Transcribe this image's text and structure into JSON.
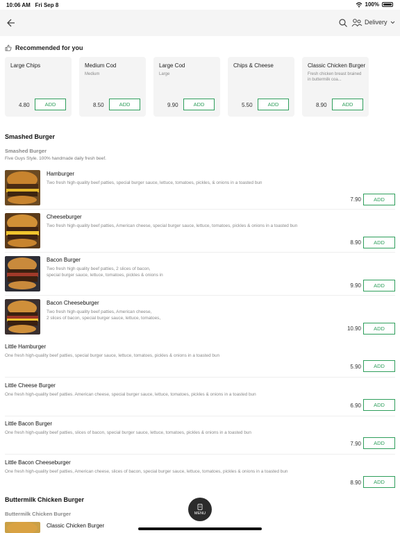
{
  "status": {
    "time": "10:06 AM",
    "date": "Fri Sep 8",
    "battery": "100%"
  },
  "header": {
    "delivery_label": "Delivery"
  },
  "recommended": {
    "title": "Recommended for you",
    "items": [
      {
        "name": "Large Chips",
        "desc": "",
        "price": "4.80",
        "button": "ADD"
      },
      {
        "name": "Medium Cod",
        "desc": "Medium",
        "price": "8.50",
        "button": "ADD"
      },
      {
        "name": "Large Cod",
        "desc": "Large",
        "price": "9.90",
        "button": "ADD"
      },
      {
        "name": "Chips & Cheese",
        "desc": "",
        "price": "5.50",
        "button": "ADD"
      },
      {
        "name": "Classic Chicken Burger",
        "desc": "Fresh chicken breast brained in buttermilk coa...",
        "price": "8.90",
        "button": "ADD"
      }
    ]
  },
  "section1": {
    "title": "Smashed Burger",
    "subtitle": "Smashed Burger",
    "subdesc": "Five Guys Style. 100% handmade daily fresh beef.",
    "items": [
      {
        "name": "Hamburger",
        "desc": "Two fresh high-quality beef patties, special burger sauce, lettuce, tomatoes, pickles, & onions in a toasted bun",
        "price": "7.90",
        "button": "ADD"
      },
      {
        "name": "Cheeseburger",
        "desc": "Two fresh high-quality beef patties, American cheese, special burger sauce, lettuce, tomatoes, pickles & onions in a toasted bun",
        "price": "8.90",
        "button": "ADD"
      },
      {
        "name": "Bacon Burger",
        "desc": "Two fresh high quality beef patties, 2 slices of bacon,\nspecial burger sauce, lettuce, tomatoes, pickles & onions in",
        "price": "9.90",
        "button": "ADD"
      },
      {
        "name": "Bacon Cheeseburger",
        "desc": "Two fresh high-quality beef patties, American cheese,\n2 slices of bacon, special burger sauce, lettuce, tomatoes,",
        "price": "10.90",
        "button": "ADD"
      },
      {
        "name": "Little Hamburger",
        "desc": "One fresh high-quality beef patties, special burger sauce, lettuce, tomatoes, pickles & onions in a toasted bun",
        "price": "5.90",
        "button": "ADD"
      },
      {
        "name": "Little Cheese Burger",
        "desc": "One fresh high-quality beef patties. American cheese, special burger sauce, lettuce, tomatoes, pickles & onions in a toasted bun",
        "price": "6.90",
        "button": "ADD"
      },
      {
        "name": "Little Bacon Burger",
        "desc": "One fresh high-quality beef patties, slices of bacon, special burger sauce, lettuce, tomatoes, pickles & onions in a toasted bun",
        "price": "7.90",
        "button": "ADD"
      },
      {
        "name": "Little Bacon Cheeseburger",
        "desc": "One fresh high-quality beef patties, American cheese, slices of bacon, special burger sauce, lettuce, tomatoes, pickles & onions in a toasted bun",
        "price": "8.90",
        "button": "ADD"
      }
    ]
  },
  "section2": {
    "title": "Buttermilk Chicken Burger",
    "subtitle": "Buttermilk Chicken Burger",
    "first_item": "Classic Chicken Burger"
  },
  "fab": {
    "label": "MENU"
  },
  "colors": {
    "accent": "#2e9e5b",
    "header_bg": "#f5f5f5",
    "fab_bg": "#2b2b2b"
  }
}
